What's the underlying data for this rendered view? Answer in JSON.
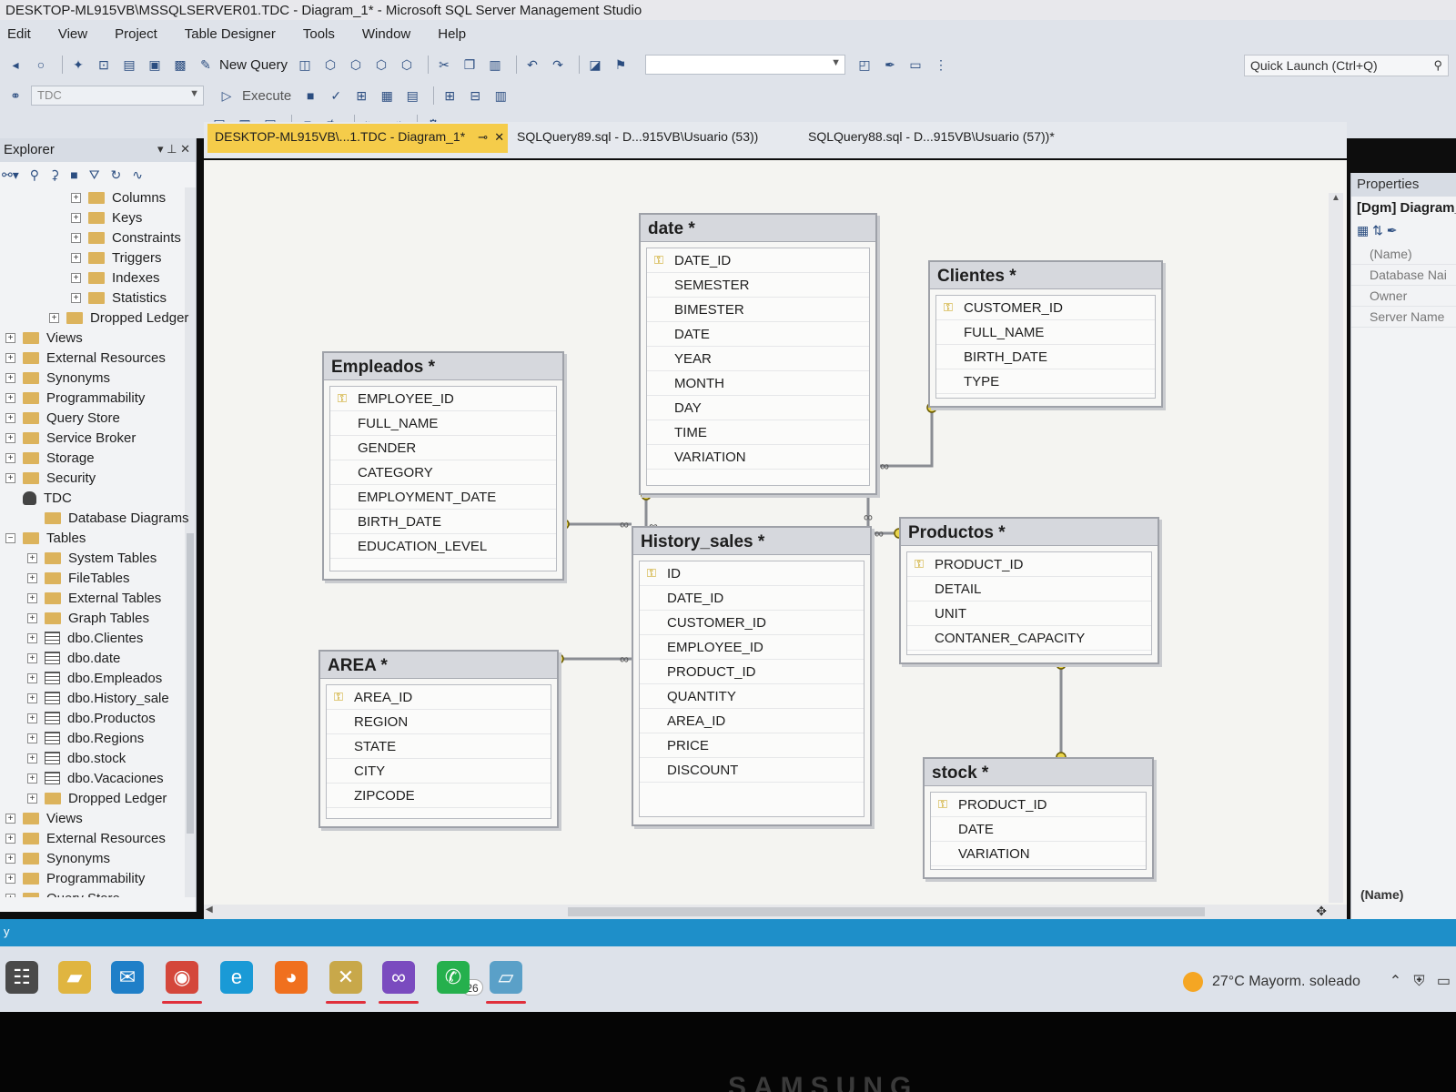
{
  "window": {
    "title": "DESKTOP-ML915VB\\MSSQLSERVER01.TDC - Diagram_1* - Microsoft SQL Server Management Studio"
  },
  "menu": [
    "Edit",
    "View",
    "Project",
    "Table Designer",
    "Tools",
    "Window",
    "Help"
  ],
  "quick_launch": {
    "placeholder": "Quick Launch (Ctrl+Q)"
  },
  "toolbar": {
    "new_query": "New Query",
    "database": "TDC",
    "execute": "Execute"
  },
  "explorer": {
    "title": "Explorer",
    "tree": [
      {
        "label": "Columns",
        "indent": 3,
        "type": "folder",
        "exp": "+"
      },
      {
        "label": "Keys",
        "indent": 3,
        "type": "folder",
        "exp": "+"
      },
      {
        "label": "Constraints",
        "indent": 3,
        "type": "folder",
        "exp": "+"
      },
      {
        "label": "Triggers",
        "indent": 3,
        "type": "folder",
        "exp": "+"
      },
      {
        "label": "Indexes",
        "indent": 3,
        "type": "folder",
        "exp": "+"
      },
      {
        "label": "Statistics",
        "indent": 3,
        "type": "folder",
        "exp": "+"
      },
      {
        "label": "Dropped Ledger",
        "indent": 2,
        "type": "folder",
        "exp": "+"
      },
      {
        "label": "Views",
        "indent": 0,
        "type": "folder",
        "exp": "+"
      },
      {
        "label": "External Resources",
        "indent": 0,
        "type": "folder",
        "exp": "+"
      },
      {
        "label": "Synonyms",
        "indent": 0,
        "type": "folder",
        "exp": "+"
      },
      {
        "label": "Programmability",
        "indent": 0,
        "type": "folder",
        "exp": "+"
      },
      {
        "label": "Query Store",
        "indent": 0,
        "type": "folder",
        "exp": "+"
      },
      {
        "label": "Service Broker",
        "indent": 0,
        "type": "folder",
        "exp": "+"
      },
      {
        "label": "Storage",
        "indent": 0,
        "type": "folder",
        "exp": "+"
      },
      {
        "label": "Security",
        "indent": 0,
        "type": "folder",
        "exp": "+"
      },
      {
        "label": "TDC",
        "indent": 0,
        "type": "db",
        "exp": ""
      },
      {
        "label": "Database Diagrams",
        "indent": 1,
        "type": "folder",
        "exp": ""
      },
      {
        "label": "Tables",
        "indent": 0,
        "type": "folder",
        "exp": "−"
      },
      {
        "label": "System Tables",
        "indent": 1,
        "type": "folder",
        "exp": "+"
      },
      {
        "label": "FileTables",
        "indent": 1,
        "type": "folder",
        "exp": "+"
      },
      {
        "label": "External Tables",
        "indent": 1,
        "type": "folder",
        "exp": "+"
      },
      {
        "label": "Graph Tables",
        "indent": 1,
        "type": "folder",
        "exp": "+"
      },
      {
        "label": "dbo.Clientes",
        "indent": 1,
        "type": "table",
        "exp": "+"
      },
      {
        "label": "dbo.date",
        "indent": 1,
        "type": "table",
        "exp": "+"
      },
      {
        "label": "dbo.Empleados",
        "indent": 1,
        "type": "table",
        "exp": "+"
      },
      {
        "label": "dbo.History_sale",
        "indent": 1,
        "type": "table",
        "exp": "+"
      },
      {
        "label": "dbo.Productos",
        "indent": 1,
        "type": "table",
        "exp": "+"
      },
      {
        "label": "dbo.Regions",
        "indent": 1,
        "type": "table",
        "exp": "+"
      },
      {
        "label": "dbo.stock",
        "indent": 1,
        "type": "table",
        "exp": "+"
      },
      {
        "label": "dbo.Vacaciones",
        "indent": 1,
        "type": "table",
        "exp": "+"
      },
      {
        "label": "Dropped Ledger",
        "indent": 1,
        "type": "folder",
        "exp": "+"
      },
      {
        "label": "Views",
        "indent": 0,
        "type": "folder",
        "exp": "+"
      },
      {
        "label": "External Resources",
        "indent": 0,
        "type": "folder",
        "exp": "+"
      },
      {
        "label": "Synonyms",
        "indent": 0,
        "type": "folder",
        "exp": "+"
      },
      {
        "label": "Programmability",
        "indent": 0,
        "type": "folder",
        "exp": "+"
      },
      {
        "label": "Query Store",
        "indent": 0,
        "type": "folder",
        "exp": "+"
      }
    ]
  },
  "tabs": [
    {
      "label": "DESKTOP-ML915VB\\...1.TDC - Diagram_1*",
      "active": true
    },
    {
      "label": "SQLQuery89.sql - D...915VB\\Usuario (53))",
      "active": false
    },
    {
      "label": "SQLQuery88.sql - D...915VB\\Usuario (57))*",
      "active": false
    }
  ],
  "diagram": {
    "tables": [
      {
        "id": "date",
        "title": "date *",
        "columns": [
          {
            "name": "DATE_ID",
            "pk": true
          },
          {
            "name": "SEMESTER"
          },
          {
            "name": "BIMESTER"
          },
          {
            "name": "DATE"
          },
          {
            "name": "YEAR"
          },
          {
            "name": "MONTH"
          },
          {
            "name": "DAY"
          },
          {
            "name": "TIME"
          },
          {
            "name": "VARIATION"
          }
        ]
      },
      {
        "id": "clientes",
        "title": "Clientes *",
        "columns": [
          {
            "name": "CUSTOMER_ID",
            "pk": true
          },
          {
            "name": "FULL_NAME"
          },
          {
            "name": "BIRTH_DATE"
          },
          {
            "name": "TYPE"
          }
        ]
      },
      {
        "id": "empleados",
        "title": "Empleados *",
        "columns": [
          {
            "name": "EMPLOYEE_ID",
            "pk": true
          },
          {
            "name": "FULL_NAME"
          },
          {
            "name": "GENDER"
          },
          {
            "name": "CATEGORY"
          },
          {
            "name": "EMPLOYMENT_DATE"
          },
          {
            "name": "BIRTH_DATE"
          },
          {
            "name": "EDUCATION_LEVEL"
          }
        ]
      },
      {
        "id": "history",
        "title": "History_sales *",
        "columns": [
          {
            "name": "ID",
            "pk": true
          },
          {
            "name": "DATE_ID"
          },
          {
            "name": "CUSTOMER_ID"
          },
          {
            "name": "EMPLOYEE_ID"
          },
          {
            "name": "PRODUCT_ID"
          },
          {
            "name": "QUANTITY"
          },
          {
            "name": "AREA_ID"
          },
          {
            "name": "PRICE"
          },
          {
            "name": "DISCOUNT"
          }
        ]
      },
      {
        "id": "productos",
        "title": "Productos *",
        "columns": [
          {
            "name": "PRODUCT_ID",
            "pk": true
          },
          {
            "name": "DETAIL"
          },
          {
            "name": "UNIT"
          },
          {
            "name": "CONTANER_CAPACITY"
          }
        ]
      },
      {
        "id": "area",
        "title": "AREA *",
        "columns": [
          {
            "name": "AREA_ID",
            "pk": true
          },
          {
            "name": "REGION"
          },
          {
            "name": "STATE"
          },
          {
            "name": "CITY"
          },
          {
            "name": "ZIPCODE"
          }
        ]
      },
      {
        "id": "stock",
        "title": "stock *",
        "columns": [
          {
            "name": "PRODUCT_ID",
            "pk": true
          },
          {
            "name": "DATE"
          },
          {
            "name": "VARIATION"
          }
        ]
      }
    ],
    "relationships": [
      {
        "from": "empleados",
        "to": "history"
      },
      {
        "from": "area",
        "to": "history"
      },
      {
        "from": "date",
        "to": "history"
      },
      {
        "from": "clientes",
        "to": "history"
      },
      {
        "from": "productos",
        "to": "history"
      },
      {
        "from": "productos",
        "to": "stock"
      }
    ]
  },
  "properties": {
    "title": "Properties",
    "object": "[Dgm] Diagram_",
    "rows": [
      "(Name)",
      "Database Nai",
      "Owner",
      "Server Name"
    ],
    "description": "(Name)"
  },
  "statusbar": {
    "text": "y"
  },
  "taskbar": {
    "apps": [
      {
        "name": "task-view-icon",
        "color": "#4a4a4a",
        "glyph": "☷"
      },
      {
        "name": "file-explorer-icon",
        "color": "#e0b540",
        "glyph": "▰"
      },
      {
        "name": "mail-icon",
        "color": "#1f7fc8",
        "glyph": "✉"
      },
      {
        "name": "chrome-icon",
        "color": "#d4473b",
        "glyph": "◉"
      },
      {
        "name": "edge-icon",
        "color": "#1a9ad6",
        "glyph": "e"
      },
      {
        "name": "firefox-icon",
        "color": "#f0701e",
        "glyph": "◕"
      },
      {
        "name": "ssms-icon",
        "color": "#c8a84a",
        "glyph": "✕"
      },
      {
        "name": "visual-studio-icon",
        "color": "#7a4bbf",
        "glyph": "∞"
      },
      {
        "name": "whatsapp-icon",
        "color": "#25b04d",
        "glyph": "✆"
      },
      {
        "name": "app-icon",
        "color": "#5aa0c8",
        "glyph": "▱"
      }
    ],
    "whatsapp_badge": "26",
    "weather": "27°C  Mayorm. soleado"
  },
  "bezel": {
    "brand": "SAMSUNG"
  }
}
